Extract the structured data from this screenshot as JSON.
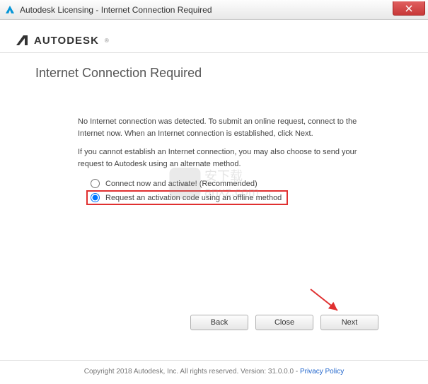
{
  "window": {
    "title": "Autodesk Licensing - Internet Connection Required"
  },
  "brand": {
    "name": "AUTODESK"
  },
  "page": {
    "title": "Internet Connection Required",
    "para1": "No Internet connection was detected. To submit an online request, connect to the Internet now. When an Internet connection is established, click Next.",
    "para2": "If you cannot establish an Internet connection, you may also choose to send your request to Autodesk using an alternate method."
  },
  "options": {
    "opt1": "Connect now and activate! (Recommended)",
    "opt2": "Request an activation code using an offline method"
  },
  "buttons": {
    "back": "Back",
    "close": "Close",
    "next": "Next"
  },
  "footer": {
    "copyright": "Copyright 2018 Autodesk, Inc. All rights reserved. Version: 31.0.0.0 - ",
    "privacy": "Privacy Policy"
  },
  "watermark": {
    "text1": "安下载",
    "text2": "anxz.com"
  }
}
